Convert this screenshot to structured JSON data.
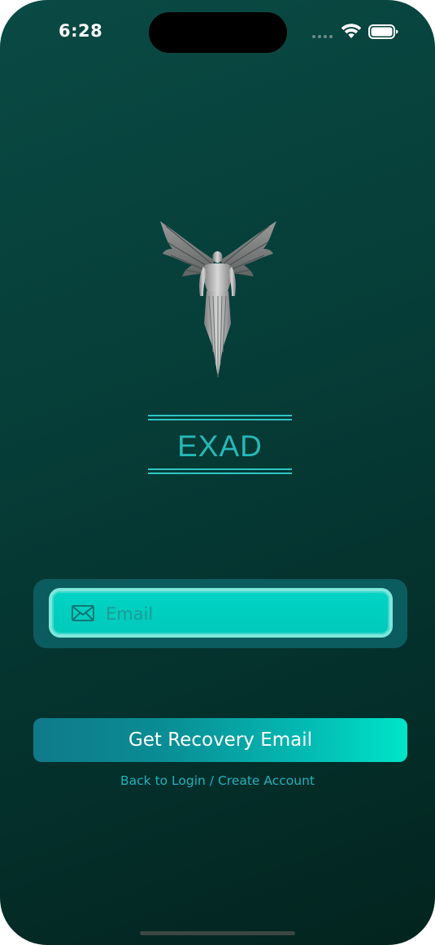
{
  "status_bar": {
    "time": "6:28",
    "wifi_icon": "wifi-icon",
    "battery_icon": "battery-icon"
  },
  "brand": {
    "logo_icon": "winged-figure-logo",
    "title": "EXAD"
  },
  "form": {
    "email_placeholder": "Email",
    "email_value": "",
    "email_icon": "mail-icon",
    "submit_label": "Get Recovery Email"
  },
  "links": {
    "back_to_login": "Back to Login",
    "separator": " / ",
    "create_account": "Create Account"
  },
  "colors": {
    "background": "#063d38",
    "accent": "#00d4c4",
    "title": "#27b8b8",
    "link": "#1fb3c0"
  }
}
